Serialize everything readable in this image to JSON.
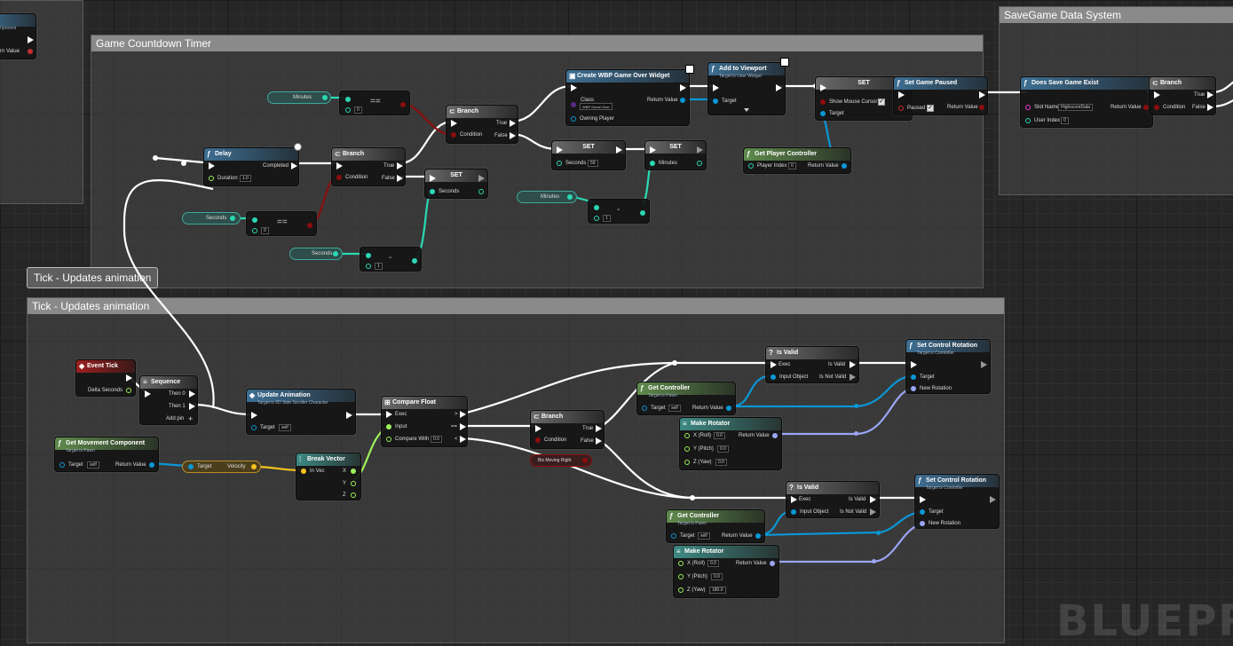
{
  "comments": {
    "left_partial": {
      "pin_text": "omponent",
      "return_value": "rn Value"
    },
    "countdown": {
      "title": "Game Countdown Timer"
    },
    "savegame": {
      "title": "SaveGame Data System"
    },
    "tick": {
      "title": "Tick - Updates animation",
      "bubble": "Tick - Updates animation"
    }
  },
  "watermark": "BLUEPR",
  "countdown": {
    "var_minutes": "Minutes",
    "var_seconds": "Seconds",
    "var_seconds2": "Seconds",
    "var_minutes2": "Minutes",
    "eq1": {
      "op": "==",
      "val": "0"
    },
    "eq2": {
      "op": "==",
      "val": "0"
    },
    "sub1": {
      "op": "-",
      "val": "1"
    },
    "sub2": {
      "op": "-",
      "val": "1"
    },
    "delay": {
      "title": "Delay",
      "completed": "Completed",
      "duration": "Duration",
      "duration_val": "1.0"
    },
    "branch1": {
      "title": "Branch",
      "true": "True",
      "false": "False",
      "condition": "Condition"
    },
    "branch2": {
      "title": "Branch",
      "true": "True",
      "false": "False",
      "condition": "Condition"
    },
    "set_seconds": {
      "title": "SET",
      "pin": "Seconds"
    },
    "set_seconds59": {
      "title": "SET",
      "pin": "Seconds",
      "val": "59"
    },
    "set_minutes": {
      "title": "SET",
      "pin": "Minutes"
    },
    "create_widget": {
      "title": "Create WBP Game Over Widget",
      "class": "Class",
      "class_val": "WBP Game Over",
      "return": "Return Value",
      "owning": "Owning Player"
    },
    "add_viewport": {
      "title": "Add to Viewport",
      "sub": "Target is User Widget",
      "target": "Target"
    },
    "set_mouse": {
      "title": "SET",
      "pin": "Show Mouse Cursor",
      "target": "Target"
    },
    "get_pc": {
      "title": "Get Player Controller",
      "player_index": "Player Index",
      "player_index_val": "0",
      "return": "Return Value"
    },
    "set_paused": {
      "title": "Set Game Paused",
      "paused": "Paused",
      "return": "Return Value"
    }
  },
  "savegame": {
    "exists": {
      "title": "Does Save Game Exist",
      "slot": "Slot Name",
      "slot_val": "HighscoreData",
      "user": "User Index",
      "user_val": "0",
      "return": "Return Value"
    },
    "branch": {
      "title": "Branch",
      "true": "True",
      "false": "False",
      "condition": "Condition"
    }
  },
  "tick": {
    "event_tick": {
      "title": "Event Tick",
      "delta": "Delta Seconds"
    },
    "sequence": {
      "title": "Sequence",
      "then0": "Then 0",
      "then1": "Then 1",
      "addpin": "Add pin"
    },
    "update_anim": {
      "title": "Update Animation",
      "sub": "Target is 2D Side Scroller Character",
      "target": "Target",
      "target_val": "self"
    },
    "get_move": {
      "title": "Get Movement Component",
      "sub": "Target is Pawn",
      "target": "Target",
      "target_val": "self",
      "return": "Return Value"
    },
    "velocity": {
      "target": "Target",
      "velocity": "Velocity"
    },
    "break_vec": {
      "title": "Break Vector",
      "invec": "In Vec",
      "x": "X",
      "y": "Y",
      "z": "Z"
    },
    "compare": {
      "title": "Compare Float",
      "exec": "Exec",
      "input": "Input",
      "compare_with": "Compare With",
      "compare_val": "0.0",
      "gt": ">",
      "eq": "==",
      "lt": "<"
    },
    "branch": {
      "title": "Branch",
      "true": "True",
      "false": "False",
      "condition": "Condition"
    },
    "bis_var": "Bis Moving Right",
    "isvalid1": {
      "title": "Is Valid",
      "exec": "Exec",
      "input": "Input Object",
      "is_valid": "Is Valid",
      "is_not_valid": "Is Not Valid"
    },
    "isvalid2": {
      "title": "Is Valid",
      "exec": "Exec",
      "input": "Input Object",
      "is_valid": "Is Valid",
      "is_not_valid": "Is Not Valid"
    },
    "getctrl1": {
      "title": "Get Controller",
      "sub": "Target is Pawn",
      "target": "Target",
      "target_val": "self",
      "return": "Return Value"
    },
    "getctrl2": {
      "title": "Get Controller",
      "sub": "Target is Pawn",
      "target": "Target",
      "target_val": "self",
      "return": "Return Value"
    },
    "rot1": {
      "title": "Make Rotator",
      "x": "X (Roll)",
      "y": "Y (Pitch)",
      "z": "Z (Yaw)",
      "x_val": "0.0",
      "y_val": "0.0",
      "z_val": "0.0",
      "return": "Return Value"
    },
    "rot2": {
      "title": "Make Rotator",
      "x": "X (Roll)",
      "y": "Y (Pitch)",
      "z": "Z (Yaw)",
      "x_val": "0.0",
      "y_val": "0.0",
      "z_val": "180.0",
      "return": "Return Value"
    },
    "setrot1": {
      "title": "Set Control Rotation",
      "sub": "Target is Controller",
      "target": "Target",
      "new_rot": "New Rotation"
    },
    "setrot2": {
      "title": "Set Control Rotation",
      "sub": "Target is Controller",
      "target": "Target",
      "new_rot": "New Rotation"
    }
  },
  "colors": {
    "exec_wire": "#ffffff",
    "int_wire": "#2bd8b3",
    "bool_wire": "#8c0d0d",
    "object_wire": "#0a97d6",
    "vector_wire": "#f5c21f",
    "float_wire": "#9cf05a",
    "rotator_wire": "#9aa5f5",
    "func_header": "#3e6f93",
    "pure_header": "#5f8b4d",
    "event_header": "#9c1f1f"
  }
}
